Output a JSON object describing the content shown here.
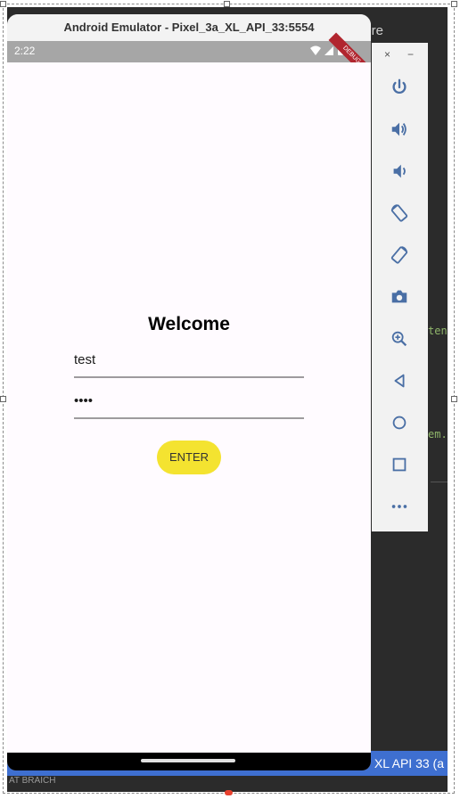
{
  "emulator": {
    "title": "Android Emulator - Pixel_3a_XL_API_33:5554",
    "status_time": "2:22",
    "debug_banner": "DEBUG"
  },
  "app": {
    "heading": "Welcome",
    "username_value": "test",
    "password_value": "••••",
    "enter_label": "ENTER",
    "enter_color": "#f4e330"
  },
  "toolbar": {
    "close_label": "×",
    "minimize_label": "−",
    "buttons": [
      "power-icon",
      "volume-up-icon",
      "volume-down-icon",
      "rotate-left-icon",
      "rotate-right-icon",
      "camera-icon",
      "zoom-icon",
      "back-icon",
      "home-icon",
      "overview-icon",
      "more-icon"
    ]
  },
  "ide": {
    "top_text": "nore",
    "code_line_1": "ten",
    "code_line_2": "em.",
    "status_text": "XL API 33 (a",
    "bottom_text": "AT BRAICH"
  }
}
